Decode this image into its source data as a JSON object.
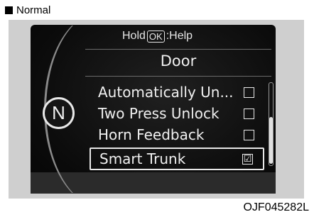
{
  "mode_label": "Normal",
  "hint": {
    "prefix": "Hold",
    "key": "OK",
    "suffix": ":Help"
  },
  "menu": {
    "title": "Door",
    "items": [
      {
        "label": "Automatically Un...",
        "checked": false
      },
      {
        "label": "Two Press Unlock",
        "checked": false
      },
      {
        "label": "Horn Feedback",
        "checked": false
      },
      {
        "label": "Smart Trunk",
        "checked": true
      }
    ]
  },
  "gear": "N",
  "code": "OJF045282L",
  "check_glyph": "☑"
}
